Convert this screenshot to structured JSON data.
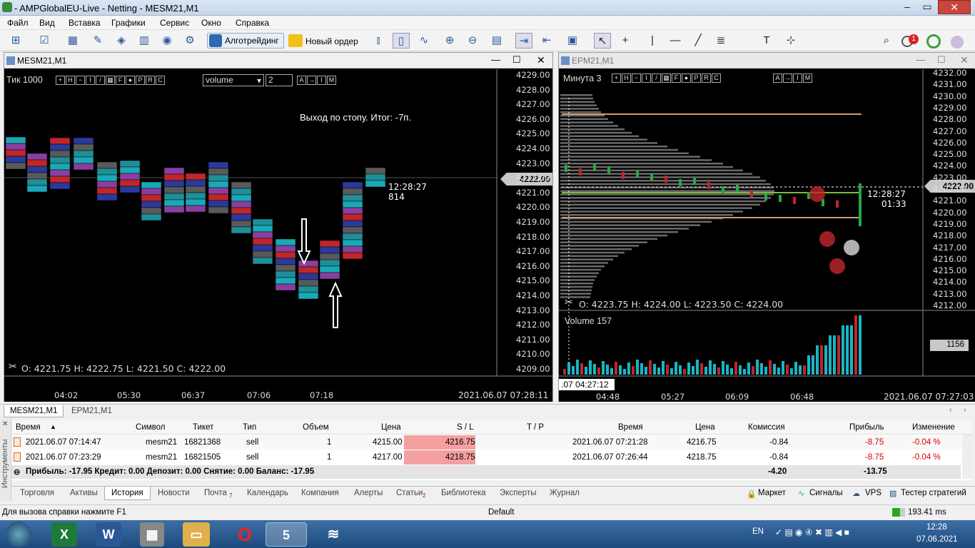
{
  "app": {
    "title": "- AMPGlobalEU-Live - Netting - MESM21,M1"
  },
  "menu": [
    "Файл",
    "Вид",
    "Вставка",
    "Графики",
    "Сервис",
    "Окно",
    "Справка"
  ],
  "toolbar": {
    "algo": "Алготрейдинг",
    "neworder": "Новый ордер",
    "notif_count": "1"
  },
  "chart1": {
    "tab_title": "MESM21,M1",
    "timeframe_label": "Тик  1000",
    "indicator_select": "volume",
    "indicator_param": "2",
    "annotation": "Выход по стопу. Итог: -7п.",
    "timer": "12:28:27",
    "timer_count": "814",
    "current_price": "4222.00",
    "ohlc": "O: 4221.75  H: 4222.75  L: 4221.50  C: 4222.00",
    "date_label": "2021.06.07 07:28:11",
    "time_ticks": [
      "04:02",
      "05:30",
      "06:37",
      "07:06",
      "07:18"
    ],
    "price_axis": [
      "4229.00",
      "4228.00",
      "4227.00",
      "4226.00",
      "4225.00",
      "4224.00",
      "4223.00",
      "4222.00",
      "4221.00",
      "4220.00",
      "4219.00",
      "4218.00",
      "4217.00",
      "4216.00",
      "4215.00",
      "4214.00",
      "4213.00",
      "4212.00",
      "4211.00",
      "4210.00",
      "4209.00"
    ]
  },
  "chart2": {
    "tab_title": "EPM21,M1",
    "timeframe_label": "Минута  3",
    "timer": "12:28:27",
    "timer2": "01:33",
    "current_price": "4222.00",
    "ohlc": "O: 4223.75  H: 4224.00  L: 4223.50  C: 4224.00",
    "volume_label": "Volume 157",
    "volume_value": "1156",
    "crosshair_time": ".07 04:27:12",
    "date_label": "2021.06.07 07:27:03",
    "time_ticks": [
      "04:48",
      "05:27",
      "06:09",
      "06:48"
    ],
    "price_axis": [
      "4232.00",
      "4231.00",
      "4230.00",
      "4229.00",
      "4228.00",
      "4227.00",
      "4226.00",
      "4225.00",
      "4224.00",
      "4223.00",
      "4222.00",
      "4221.00",
      "4220.00",
      "4219.00",
      "4218.00",
      "4217.00",
      "4216.00",
      "4215.00",
      "4214.00",
      "4213.00",
      "4212.00"
    ]
  },
  "chart_tabs": [
    "MESM21,M1",
    "EPM21,M1"
  ],
  "history_table": {
    "headers": [
      "Время",
      "Символ",
      "Тикет",
      "Тип",
      "Объем",
      "Цена",
      "S / L",
      "T / P",
      "Время",
      "Цена",
      "Комиссия",
      "Прибыль",
      "Изменение"
    ],
    "rows": [
      [
        "2021.06.07 07:14:47",
        "mesm21",
        "16821368",
        "sell",
        "1",
        "4215.00",
        "4216.75",
        "",
        "2021.06.07 07:21:28",
        "4216.75",
        "-0.84",
        "-8.75",
        "-0.04 %"
      ],
      [
        "2021.06.07 07:23:29",
        "mesm21",
        "16821505",
        "sell",
        "1",
        "4217.00",
        "4218.75",
        "",
        "2021.06.07 07:26:44",
        "4218.75",
        "-0.84",
        "-8.75",
        "-0.04 %"
      ]
    ],
    "summary": "Прибыль: -17.95  Кредит: 0.00  Депозит: 0.00  Снятие: 0.00  Баланс: -17.95",
    "summary_commission": "-4.20",
    "summary_profit": "-13.75"
  },
  "side_label": "Инструменты",
  "bottom_tabs": [
    "Торговля",
    "Активы",
    "История",
    "Новости",
    "Почта",
    "Календарь",
    "Компания",
    "Алерты",
    "Статьи",
    "Библиотека",
    "Эксперты",
    "Журнал"
  ],
  "mail_count": "7",
  "articles_count": "2",
  "right_links": [
    "Маркет",
    "Сигналы",
    "VPS",
    "Тестер стратегий"
  ],
  "status": {
    "help": "Для вызова справки нажмите F1",
    "profile": "Default",
    "ping": "193.41 ms"
  },
  "tray": {
    "lang": "EN",
    "time": "12:28",
    "date": "07.06.2021"
  },
  "colors": {
    "bid_line": "#7dbb3a",
    "stop_line": "#d89a6a",
    "bull": "#27a845",
    "bear": "#c0262b",
    "volume_cyan": "#16b6c6"
  }
}
